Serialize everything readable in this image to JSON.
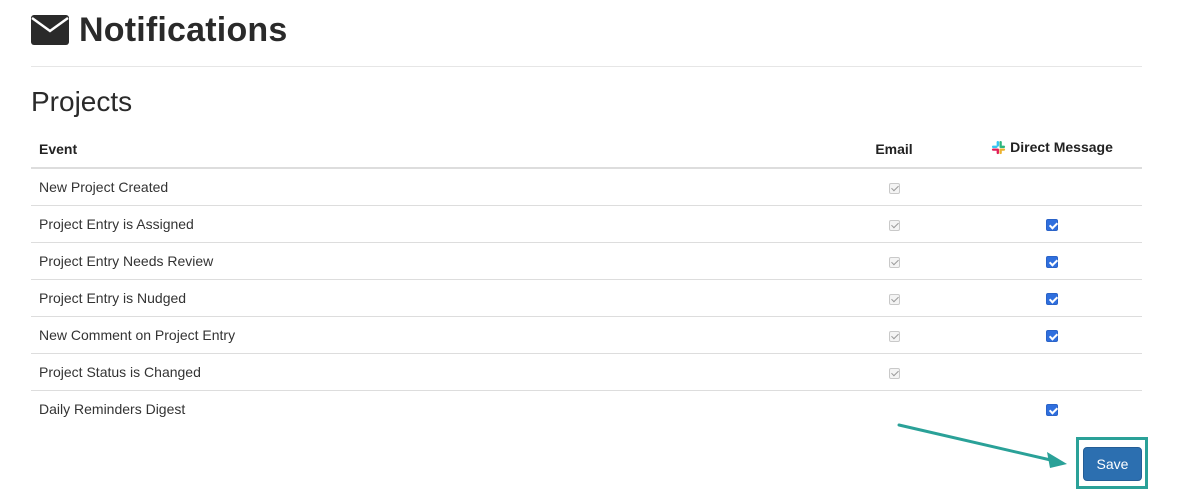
{
  "header": {
    "title": "Notifications",
    "icon": "envelope-icon"
  },
  "section": {
    "title": "Projects"
  },
  "table": {
    "columns": {
      "event": "Event",
      "email": "Email",
      "direct_message": "Direct Message",
      "direct_message_icon": "slack-icon"
    },
    "rows": [
      {
        "event": "New Project Created",
        "email": true,
        "direct_message": null
      },
      {
        "event": "Project Entry is Assigned",
        "email": true,
        "direct_message": true
      },
      {
        "event": "Project Entry Needs Review",
        "email": true,
        "direct_message": true
      },
      {
        "event": "Project Entry is Nudged",
        "email": true,
        "direct_message": true
      },
      {
        "event": "New Comment on Project Entry",
        "email": true,
        "direct_message": true
      },
      {
        "event": "Project Status is Changed",
        "email": true,
        "direct_message": null
      },
      {
        "event": "Daily Reminders Digest",
        "email": null,
        "direct_message": true
      }
    ]
  },
  "actions": {
    "save_label": "Save"
  },
  "colors": {
    "accent": "#2c6fb0",
    "checkbox_active": "#2f6fde",
    "annotation": "#2aa198"
  }
}
